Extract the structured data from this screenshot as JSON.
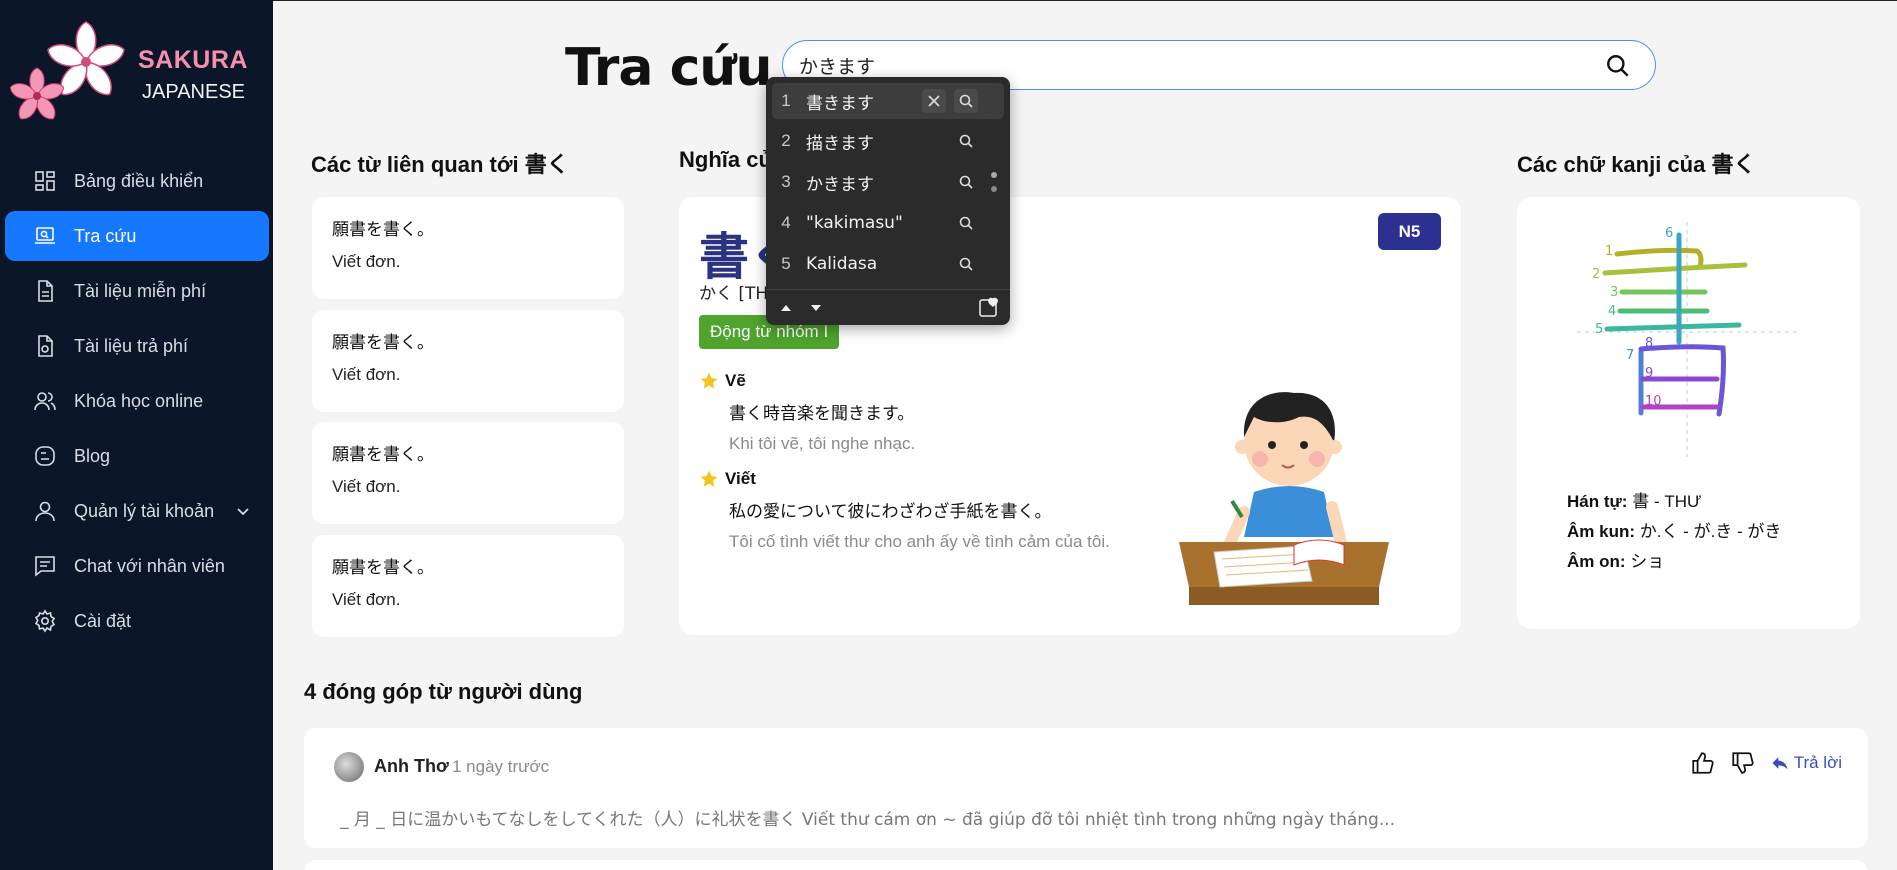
{
  "sidebar": {
    "brand_line1": "SAKURA",
    "brand_line2": "JAPANESE",
    "items": [
      {
        "label": "Bảng điều khiển",
        "icon": "dashboard-icon"
      },
      {
        "label": "Tra cứu",
        "icon": "laptop-search-icon",
        "active": true
      },
      {
        "label": "Tài liệu miễn phí",
        "icon": "document-icon"
      },
      {
        "label": "Tài liệu trả phí",
        "icon": "paid-document-icon"
      },
      {
        "label": "Khóa học online",
        "icon": "users-icon"
      },
      {
        "label": "Blog",
        "icon": "blog-icon"
      },
      {
        "label": "Quản lý tài khoản",
        "icon": "user-icon"
      },
      {
        "label": "Chat với nhân viên",
        "icon": "chat-icon"
      },
      {
        "label": "Cài đặt",
        "icon": "gear-icon"
      }
    ]
  },
  "header": {
    "title": "Tra cứu",
    "search_value": "かきます"
  },
  "ime": {
    "candidates": [
      {
        "num": "1",
        "text": "書きます"
      },
      {
        "num": "2",
        "text": "描きます"
      },
      {
        "num": "3",
        "text": "かきます"
      },
      {
        "num": "4",
        "text": "\"kakimasu\""
      },
      {
        "num": "5",
        "text": "Kalidasa"
      }
    ]
  },
  "related": {
    "title": "Các từ liên quan tới 書く",
    "items": [
      {
        "jp": "願書を書く。",
        "vi": "Viết đơn."
      },
      {
        "jp": "願書を書く。",
        "vi": "Viết đơn."
      },
      {
        "jp": "願書を書く。",
        "vi": "Viết đơn."
      },
      {
        "jp": "願書を書く。",
        "vi": "Viết đơn."
      }
    ]
  },
  "meaning": {
    "title": "Nghĩa củ",
    "word": "書く",
    "reading": "かく [TH",
    "level": "N5",
    "verb_group": "Động từ nhóm I",
    "senses": [
      {
        "head": "Vẽ",
        "jp": "書く時音楽を聞きます。",
        "vi": "Khi tôi vẽ, tôi nghe nhạc."
      },
      {
        "head": "Viết",
        "jp": "私の愛について彼にわざわざ手紙を書く。",
        "vi": "Tôi cố tình viết thư cho anh ấy về tình cảm của tôi."
      }
    ]
  },
  "kanji": {
    "title": "Các chữ kanji của 書く",
    "han_label": "Hán tự:",
    "han_value": "書 - THƯ",
    "kun_label": "Âm kun:",
    "kun_value": "か.く - が.き - がき",
    "on_label": "Âm on:",
    "on_value": "ショ",
    "stroke_numbers": [
      "1",
      "2",
      "3",
      "4",
      "5",
      "6",
      "7",
      "8",
      "9",
      "10"
    ]
  },
  "comments": {
    "title": "4 đóng góp từ người dùng",
    "items": [
      {
        "user": "Anh Thơ",
        "time": "1 ngày trước",
        "text": "_ 月 _ 日に温かいもてなしをしてくれた（人）に礼状を書く Viết thư cám ơn ~ đã giúp đỡ tôi nhiệt tình trong những ngày tháng...",
        "reply_label": "Trả lời"
      }
    ]
  },
  "colors": {
    "sidebar_bg": "#0b1629",
    "active": "#1677ff",
    "brand_pink": "#f58fb0",
    "n5_badge": "#2c3191",
    "verb_group": "#4ea42d"
  }
}
